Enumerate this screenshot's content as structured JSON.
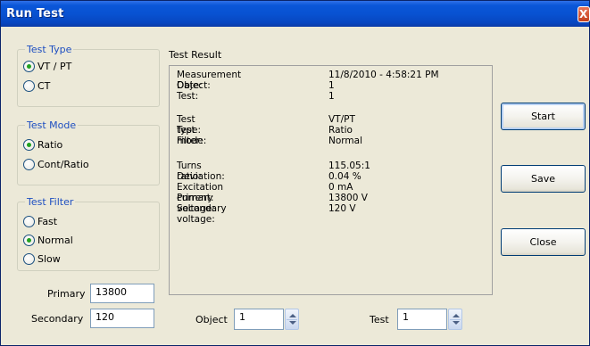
{
  "window": {
    "title": "Run Test",
    "close_glyph": "X"
  },
  "test_type": {
    "legend": "Test Type",
    "options": [
      {
        "label": "VT / PT",
        "selected": true
      },
      {
        "label": "CT",
        "selected": false
      }
    ]
  },
  "test_mode": {
    "legend": "Test Mode",
    "options": [
      {
        "label": "Ratio",
        "selected": true
      },
      {
        "label": "Cont/Ratio",
        "selected": false
      }
    ]
  },
  "test_filter": {
    "legend": "Test Filter",
    "options": [
      {
        "label": "Fast",
        "selected": false
      },
      {
        "label": "Normal",
        "selected": true
      },
      {
        "label": "Slow",
        "selected": false
      }
    ]
  },
  "fields": {
    "primary_label": "Primary",
    "primary_value": "13800",
    "secondary_label": "Secondary",
    "secondary_value": "120",
    "object_label": "Object",
    "object_value": "1",
    "test_label": "Test",
    "test_value": "1"
  },
  "result": {
    "title": "Test Result",
    "rows": [
      {
        "key": "Measurement Date:",
        "value": "11/8/2010 - 4:58:21 PM"
      },
      {
        "key": "Object:",
        "value": "1"
      },
      {
        "key": "Test:",
        "value": "1"
      },
      {
        "key": "Test type:",
        "value": "VT/PT"
      },
      {
        "key": "Test mode:",
        "value": "Ratio"
      },
      {
        "key": "Filter:",
        "value": "Normal"
      },
      {
        "key": "Turns ratio:",
        "value": "115.05:1"
      },
      {
        "key": "Deviation:",
        "value": "0.04 %"
      },
      {
        "key": "Excitation current:",
        "value": "0 mA"
      },
      {
        "key": "Primary voltage:",
        "value": "13800 V"
      },
      {
        "key": "Secondary voltage:",
        "value": "120 V"
      }
    ]
  },
  "buttons": {
    "start": "Start",
    "save": "Save",
    "close": "Close"
  }
}
